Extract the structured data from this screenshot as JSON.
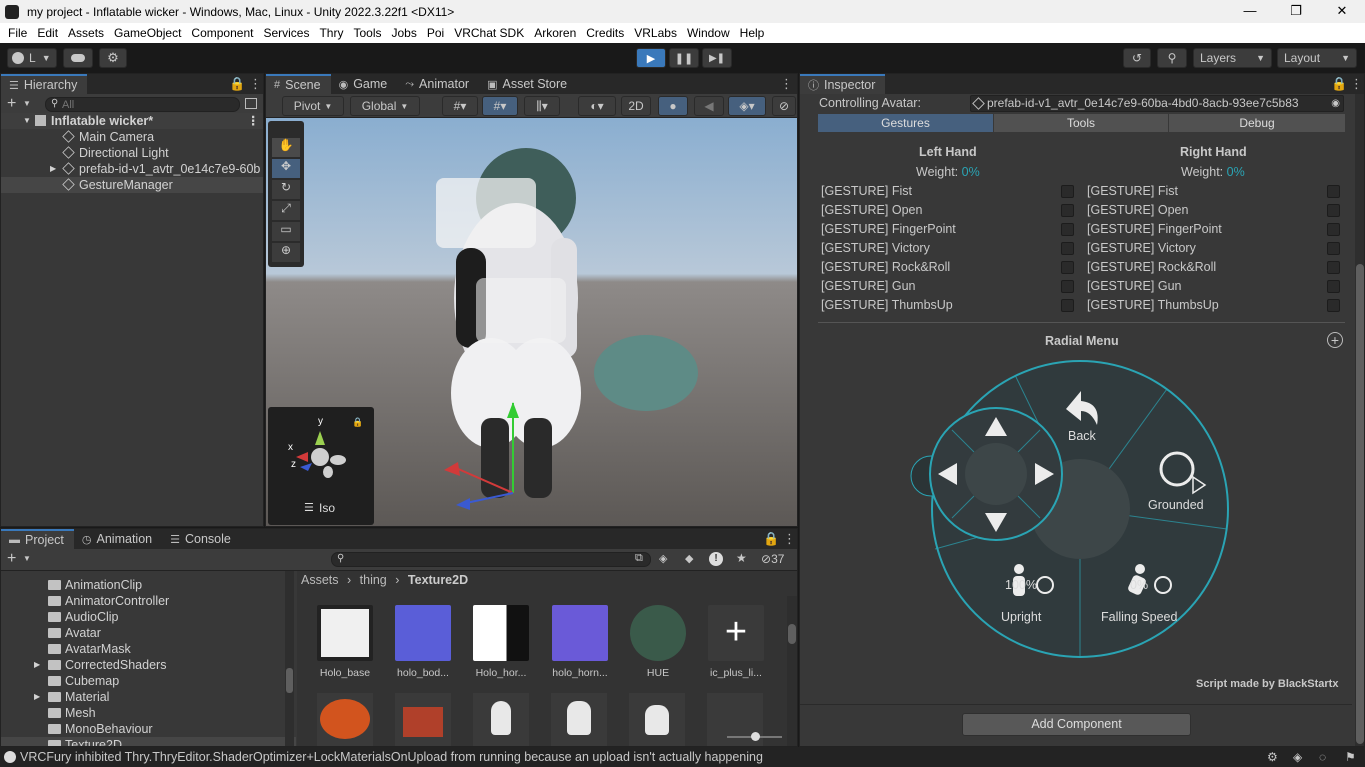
{
  "window": {
    "title": "my project - Inflatable wicker - Windows, Mac, Linux - Unity 2022.3.22f1 <DX11>",
    "minimize": "—",
    "maximize": "❐",
    "close": "✕"
  },
  "menu": [
    "File",
    "Edit",
    "Assets",
    "GameObject",
    "Component",
    "Services",
    "Thry",
    "Tools",
    "Jobs",
    "Poi",
    "VRChat SDK",
    "Arkoren",
    "Credits",
    "VRLabs",
    "Window",
    "Help"
  ],
  "toolbar": {
    "account": "L",
    "layers": "Layers",
    "layout": "Layout"
  },
  "hierarchy": {
    "tab": "Hierarchy",
    "search_placeholder": "All",
    "scene": "Inflatable wicker*",
    "items": [
      "Main Camera",
      "Directional Light",
      "prefab-id-v1_avtr_0e14c7e9-60b",
      "GestureManager"
    ]
  },
  "scene": {
    "tabs": [
      "Scene",
      "Game",
      "Animator",
      "Asset Store"
    ],
    "pivot": "Pivot",
    "global": "Global",
    "mode2d": "2D",
    "gizmo": {
      "y": "y",
      "x": "x",
      "z": "z",
      "iso": "Iso"
    }
  },
  "inspector": {
    "tab": "Inspector",
    "controlling_label": "Controlling Avatar:",
    "controlling_value": "prefab-id-v1_avtr_0e14c7e9-60ba-4bd0-8acb-93ee7c5b83",
    "tabs": [
      "Gestures",
      "Tools",
      "Debug"
    ],
    "left": {
      "title": "Left Hand",
      "weight_label": "Weight:",
      "weight": "0%"
    },
    "right": {
      "title": "Right Hand",
      "weight_label": "Weight:",
      "weight": "0%"
    },
    "gestures": [
      "[GESTURE] Fist",
      "[GESTURE] Open",
      "[GESTURE] FingerPoint",
      "[GESTURE] Victory",
      "[GESTURE] Rock&Roll",
      "[GESTURE] Gun",
      "[GESTURE] ThumbsUp"
    ],
    "radial_title": "Radial Menu",
    "radial": {
      "back": "Back",
      "grounded": "Grounded",
      "upright": "Upright",
      "upright_val": "100%",
      "falling": "Falling Speed",
      "falling_val": "0%"
    },
    "credit": "Script made by BlackStartx",
    "add_component": "Add Component"
  },
  "project": {
    "tabs": [
      "Project",
      "Animation",
      "Console"
    ],
    "count": "37",
    "folders": [
      "AnimationClip",
      "AnimatorController",
      "AudioClip",
      "Avatar",
      "AvatarMask",
      "CorrectedShaders",
      "Cubemap",
      "Material",
      "Mesh",
      "MonoBehaviour",
      "Texture2D"
    ],
    "breadcrumb": [
      "Assets",
      "thing",
      "Texture2D"
    ],
    "assets": [
      "Holo_base",
      "holo_bod...",
      "Holo_hor...",
      "holo_horn...",
      "HUE",
      "ic_plus_li..."
    ]
  },
  "status": "VRCFury inhibited Thry.ThryEditor.ShaderOptimizer+LockMaterialsOnUpload from running because an upload isn't actually happening",
  "colors": {
    "accent": "#3a79bb",
    "teal": "#2aa4b4",
    "panel": "#383838"
  }
}
